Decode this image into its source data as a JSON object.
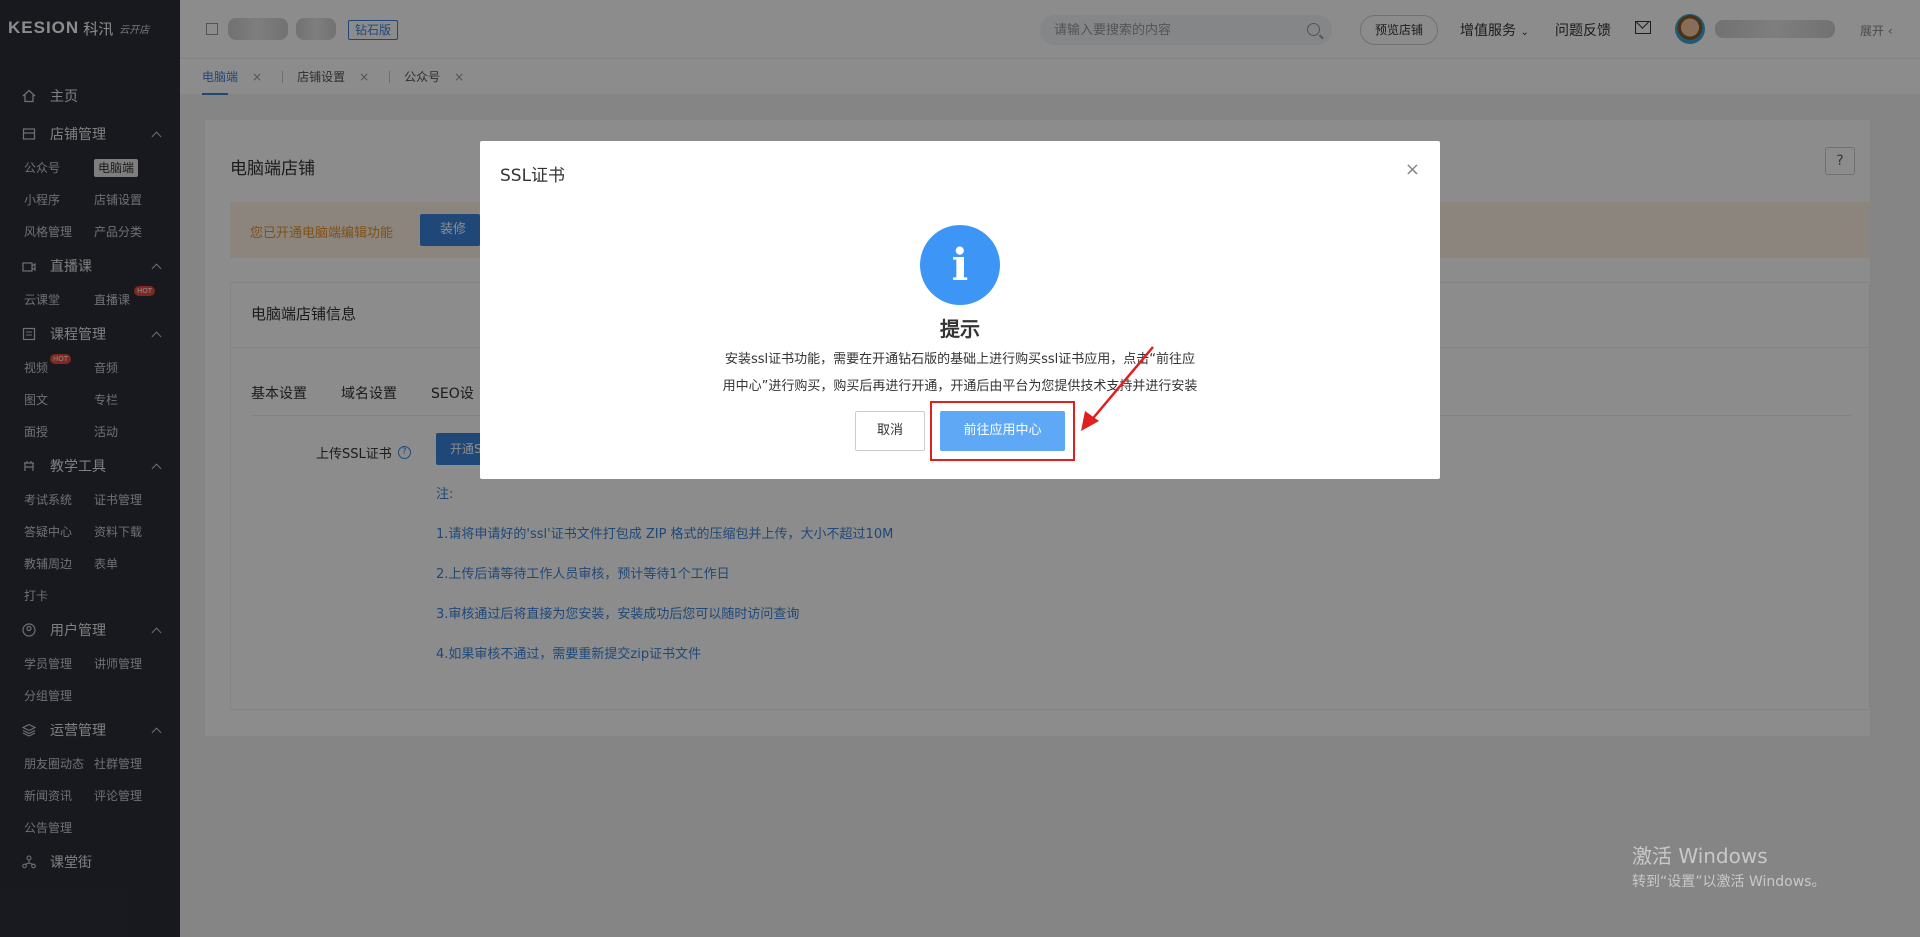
{
  "sidebar": {
    "brand": "KESION",
    "brand_cn": "科汛",
    "brand_sig": "云开店",
    "home": "主页",
    "groups": [
      {
        "title": "店铺管理",
        "items": [
          "公众号",
          "电脑端",
          "小程序",
          "店铺设置",
          "风格管理",
          "产品分类"
        ]
      },
      {
        "title": "直播课",
        "items": [
          "云课堂",
          "直播课"
        ]
      },
      {
        "title": "课程管理",
        "items": [
          "视频",
          "音频",
          "图文",
          "专栏",
          "面授",
          "活动"
        ]
      },
      {
        "title": "教学工具",
        "items": [
          "考试系统",
          "证书管理",
          "答疑中心",
          "资料下载",
          "教辅周边",
          "表单",
          "打卡"
        ]
      },
      {
        "title": "用户管理",
        "items": [
          "学员管理",
          "讲师管理",
          "分组管理"
        ]
      },
      {
        "title": "运营管理",
        "items": [
          "朋友圈动态",
          "社群管理",
          "新闻资讯",
          "评论管理",
          "公告管理"
        ]
      }
    ],
    "last": "课堂街",
    "hot_badge": "HOT"
  },
  "topbar": {
    "edition_badge": "钻石版",
    "search_placeholder": "请输入要搜索的内容",
    "preview_label": "预览店铺",
    "value_service": "增值服务",
    "feedback": "问题反馈",
    "expand": "展开"
  },
  "tabs": [
    "电脑端",
    "店铺设置",
    "公众号"
  ],
  "tab_close": "×",
  "main": {
    "title": "电脑端店铺",
    "help": "?",
    "notice": "您已开通电脑端编辑功能",
    "notice_btn": "装修",
    "card_title": "电脑端店铺信息",
    "subtabs": [
      "基本设置",
      "域名设置",
      "SEO设"
    ],
    "upload_label": "上传SSL证书",
    "open_btn": "开通S",
    "notes": [
      "注:",
      "1.请将申请好的'ssl'证书文件打包成 ZIP 格式的压缩包并上传，大小不超过10M",
      "2.上传后请等待工作人员审核，预计等待1个工作日",
      "3.审核通过后将直接为您安装，安装成功后您可以随时访问查询",
      "4.如果审核不通过，需要重新提交zip证书文件"
    ]
  },
  "modal": {
    "title": "SSL证书",
    "close": "×",
    "icon_glyph": "i",
    "heading": "提示",
    "message_line1": "安装ssl证书功能，需要在开通钻石版的基础上进行购买ssl证书应用，点击“前往应",
    "message_line2": "用中心”进行购买，购买后再进行开通，开通后由平台为您提供技术支持并进行安装",
    "cancel": "取消",
    "go": "前往应用中心"
  },
  "watermark": {
    "line1": "激活 Windows",
    "line2": "转到“设置”以激活 Windows。"
  },
  "colors": {
    "sidebar_bg": "#2b2f3a",
    "accent": "#3a84dc",
    "modal_info": "#3d96f5",
    "highlight": "#e02020"
  }
}
